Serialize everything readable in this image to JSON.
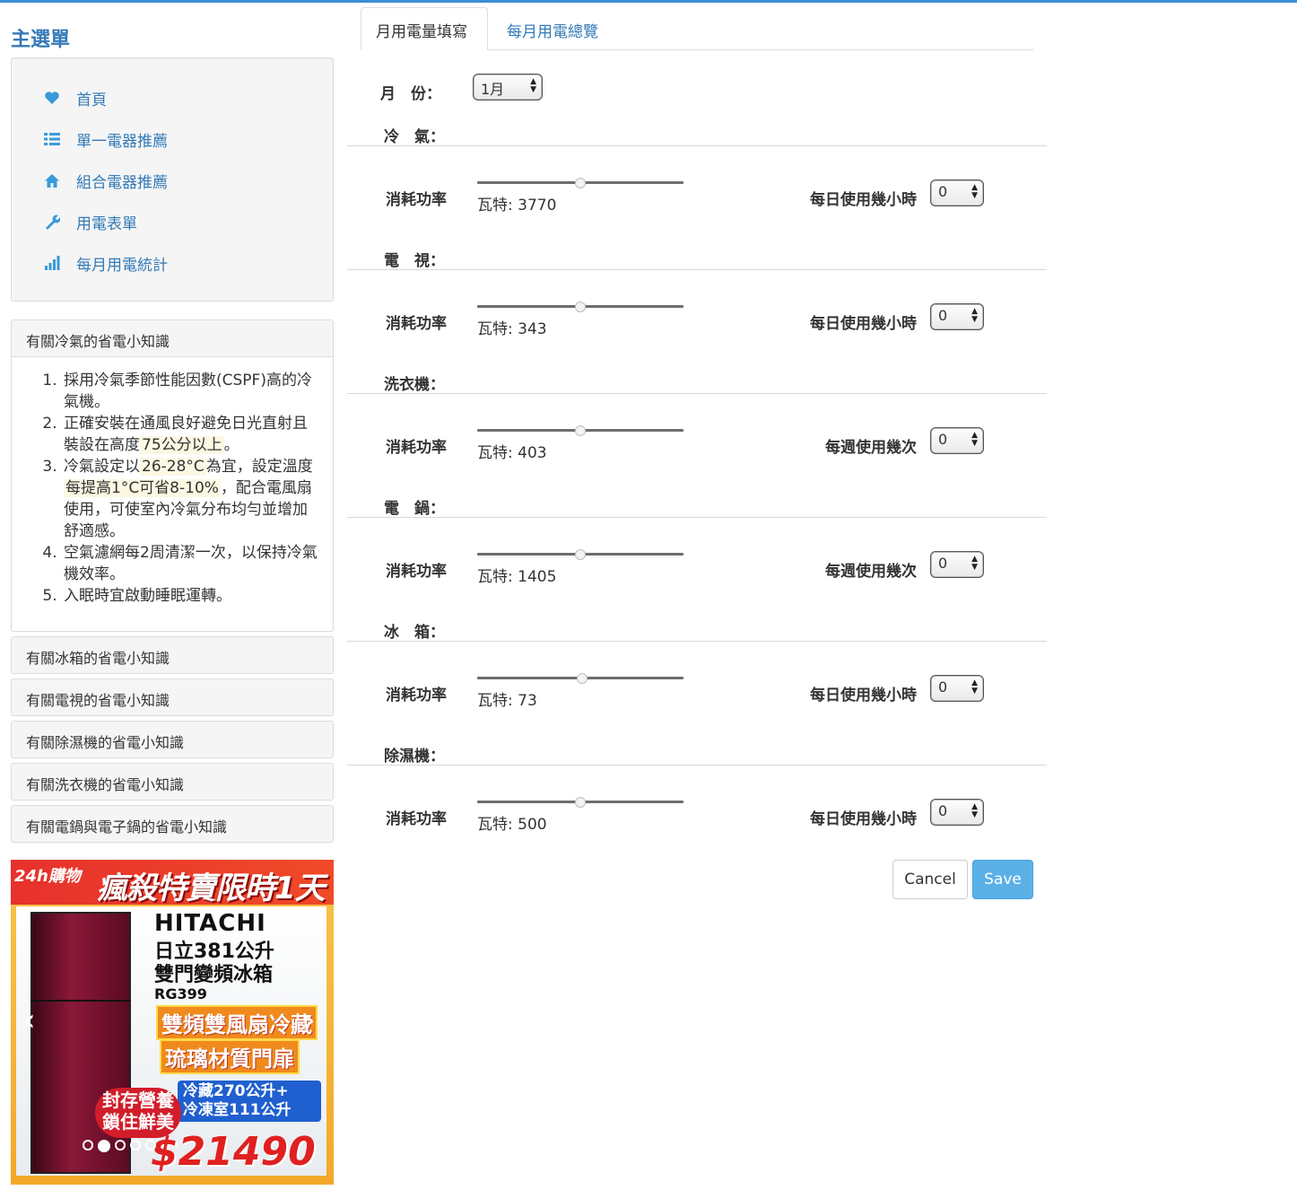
{
  "sidebar": {
    "title": "主選單",
    "items": [
      {
        "label": "首頁",
        "icon": "heart-icon"
      },
      {
        "label": "單一電器推薦",
        "icon": "list-icon"
      },
      {
        "label": "組合電器推薦",
        "icon": "home-icon"
      },
      {
        "label": "用電表單",
        "icon": "wrench-icon"
      },
      {
        "label": "每月用電統計",
        "icon": "bar-chart-icon"
      }
    ],
    "accordion": {
      "ac": {
        "title": "有關冷氣的省電小知識",
        "tips": {
          "t1": "採用冷氣季節性能因數(CSPF)高的冷氣機。",
          "t2a": "正確安裝在通風良好避免日光直射且裝設在高度",
          "t2b": "75公分以上",
          "t2c": "。",
          "t3a": "冷氣設定以",
          "t3b": "26-28°C",
          "t3c": "為宜，設定溫度",
          "t3d": "每提高1°C可省8-10%",
          "t3e": "，配合電風扇使用，可使室內冷氣分布均勻並增加舒適感。",
          "t4": "空氣濾網每2周清潔一次，以保持冷氣機效率。",
          "t5": "入眠時宜啟動睡眠運轉。"
        }
      },
      "others": [
        "有關冰箱的省電小知識",
        "有關電視的省電小知識",
        "有關除濕機的省電小知識",
        "有關洗衣機的省電小知識",
        "有關電鍋與電子鍋的省電小知識"
      ]
    },
    "ad": {
      "store": "24h購物",
      "banner": "瘋殺特賣限時1天",
      "brand": "HITACHI",
      "line1": "日立381公升",
      "line2": "雙門變頻冰箱",
      "model": "RG399",
      "tag1": "雙頻雙風扇冷藏",
      "tag2": "琉璃材質門扉",
      "spec1": "冷藏270公升+",
      "spec2": "冷凍室111公升",
      "seal1": "封存營養",
      "seal2": "鎖住鮮美",
      "price": "$21490",
      "active_slide": 2,
      "slide_count": 5
    }
  },
  "tabs": [
    "月用電量填寫",
    "每月用電總覽"
  ],
  "form": {
    "month_label": "月　份：",
    "month_value": "1月",
    "power_label": "消耗功率",
    "appliances": [
      {
        "name": "冷　氣：",
        "watt": "瓦特: 3770",
        "freq_label": "每日使用幾小時",
        "freq_value": "0",
        "slider_pos": 0.5
      },
      {
        "name": "電　視：",
        "watt": "瓦特: 343",
        "freq_label": "每日使用幾小時",
        "freq_value": "0",
        "slider_pos": 0.5
      },
      {
        "name": "洗衣機：",
        "watt": "瓦特: 403",
        "freq_label": "每週使用幾次",
        "freq_value": "0",
        "slider_pos": 0.5
      },
      {
        "name": "電　鍋：",
        "watt": "瓦特: 1405",
        "freq_label": "每週使用幾次",
        "freq_value": "0",
        "slider_pos": 0.5
      },
      {
        "name": "冰　箱：",
        "watt": "瓦特: 73",
        "freq_label": "每日使用幾小時",
        "freq_value": "0",
        "slider_pos": 0.51
      },
      {
        "name": "除濕機：",
        "watt": "瓦特: 500",
        "freq_label": "每日使用幾小時",
        "freq_value": "0",
        "slider_pos": 0.5
      }
    ],
    "cancel_label": "Cancel",
    "save_label": "Save"
  },
  "colors": {
    "link": "#337ab7",
    "primary": "#5bb0e8",
    "highlight": "#fcf8e3"
  }
}
